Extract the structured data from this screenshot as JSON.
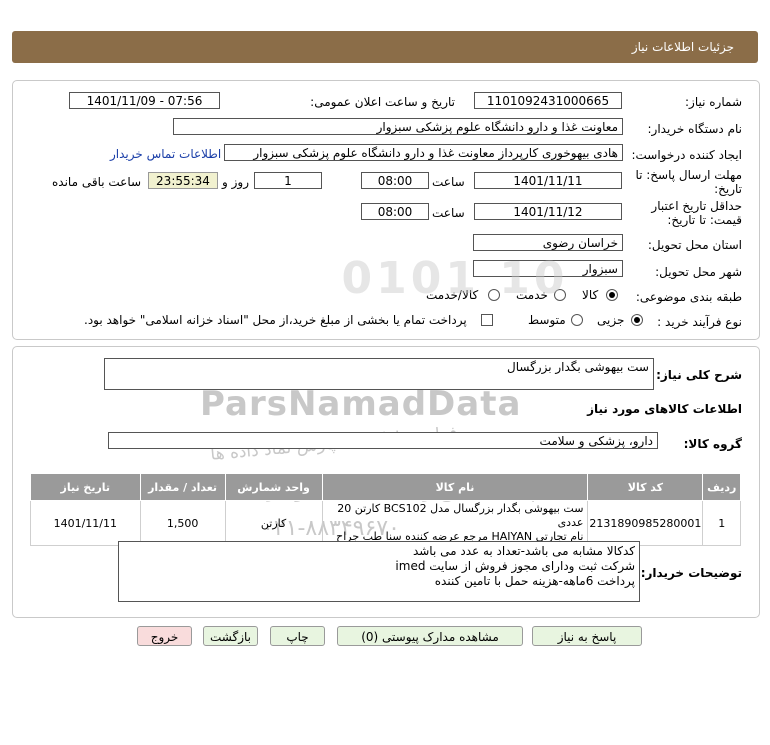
{
  "header": {
    "title": "جزئیات اطلاعات نیاز"
  },
  "form": {
    "need_number_label": "شماره نیاز:",
    "need_number": "1101092431000665",
    "announce_label": "تاریخ و ساعت اعلان عمومی:",
    "announce_value": "1401/11/09 - 07:56",
    "buyer_org_label": "نام دستگاه خریدار:",
    "buyer_org": "معاونت غذا و دارو   دانشگاه علوم پزشکی سبزوار",
    "creator_label": "ایجاد کننده درخواست:",
    "creator": "هادی بیهوخوری کارپرداز معاونت غذا و دارو   دانشگاه علوم پزشکی سبزوار",
    "contact_link": "اطلاعات تماس خریدار",
    "deadline_label_1": "مهلت ارسال پاسخ: تا",
    "deadline_label_2": "تاریخ:",
    "deadline_date": "1401/11/11",
    "time_label": "ساعت",
    "deadline_time": "08:00",
    "days_value": "1",
    "days_label": "روز و",
    "remaining_time": "23:55:34",
    "remaining_label": "ساعت باقی مانده",
    "validity_label_1": "حداقل تاریخ اعتبار",
    "validity_label_2": "قیمت: تا تاریخ:",
    "validity_date": "1401/11/12",
    "validity_time": "08:00",
    "province_label": "استان محل تحویل:",
    "province": "خراسان رضوی",
    "city_label": "شهر محل تحویل:",
    "city": "سبزوار",
    "category_label": "طبقه بندی موضوعی:",
    "category_options": [
      "کالا",
      "خدمت",
      "کالا/خدمت"
    ],
    "category_selected": "کالا",
    "process_label": "نوع فرآیند خرید :",
    "process_options": [
      "جزیی",
      "متوسط"
    ],
    "process_selected": "جزیی",
    "payment_note": "پرداخت تمام یا بخشی از مبلغ خرید،از محل \"اسناد خزانه اسلامی\" خواهد بود."
  },
  "summary": {
    "label": "شرح کلی نیاز:",
    "value": "ست بیهوشی بگدار بزرگسال"
  },
  "goods": {
    "section_title": "اطلاعات کالاهای مورد نیاز",
    "group_label": "گروه کالا:",
    "group_value": "دارو، پزشکی و سلامت",
    "columns": [
      "ردیف",
      "کد کالا",
      "نام کالا",
      "واحد شمارش",
      "تعداد / مقدار",
      "تاریخ نیاز"
    ],
    "rows": [
      {
        "index": "1",
        "code": "2131890985280001",
        "name_line1": "ست بیهوشی بگدار بزرگسال مدل BCS102 کارتن 20 عددی",
        "name_line2": "نام تجارتی HAIYAN مرجع عرضه کننده سنا طب جراح",
        "unit": "کارتن",
        "qty": "1,500",
        "date": "1401/11/11"
      }
    ]
  },
  "buyer_notes": {
    "label": "توضیحات خریدار:",
    "lines": [
      "کدکالا مشابه می باشد-تعداد به عدد می باشد",
      "شرکت ثبت ودارای مجوز فروش از سایت imed",
      "پرداخت 6ماهه-هزینه حمل با تامین کننده"
    ]
  },
  "buttons": {
    "reply": "پاسخ به نیاز",
    "attachments": "مشاهده مدارک پیوستی (0)",
    "print": "چاپ",
    "back": "بازگشت",
    "exit": "خروج"
  },
  "watermark": {
    "brand": "ParsNamadData",
    "line1": "پایگاه اطلاع رسانی مناقصه و مزایده",
    "line2": "فراوری اطلاعات پارس نماد داده ها",
    "phone": "۰۲۱-۸۸۳۴۹۶۷۰",
    "digits": "0101 10"
  },
  "colors": {
    "header_bg": "#8b6d48",
    "table_header_bg": "#9a9a9a",
    "button_bg": "#e8f5e0",
    "exit_button_bg": "#f9dcdc",
    "remaining_bg": "#f1f1cf",
    "link": "#1a3ea8"
  }
}
